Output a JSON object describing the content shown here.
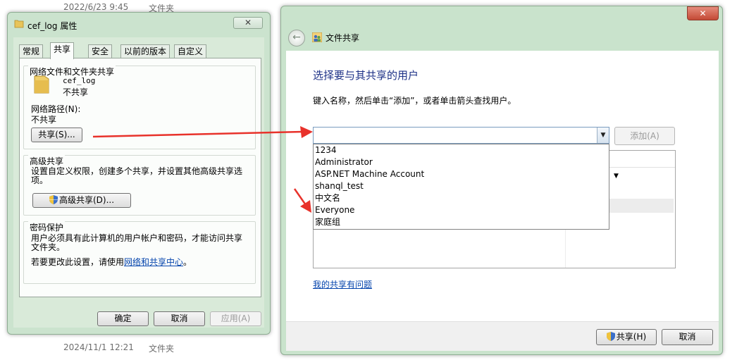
{
  "background": {
    "rows": [
      {
        "date": "2022/6/23 9:45",
        "type": "文件夹"
      },
      {
        "date": "2024/11/1 12:21",
        "type": "文件夹"
      }
    ]
  },
  "properties": {
    "title": "cef_log 属性",
    "close_label": "✕",
    "tabs": [
      "常规",
      "共享",
      "安全",
      "以前的版本",
      "自定义"
    ],
    "network_share": {
      "title": "网络文件和文件夹共享",
      "folder_name": "cef_log",
      "status": "不共享",
      "path_label": "网络路径(N):",
      "path_value": "不共享",
      "share_button": "共享(S)..."
    },
    "advanced": {
      "title": "高级共享",
      "description_line1": "设置自定义权限，创建多个共享，并设置其他高级共享选",
      "description_line2": "项。",
      "button": "高级共享(D)..."
    },
    "password": {
      "title": "密码保护",
      "line1": "用户必须具有此计算机的用户帐户和密码，才能访问共享",
      "line2": "文件夹。",
      "change_text": "若要更改此设置，请使用",
      "link_text": "网络和共享中心",
      "after_link": "。"
    },
    "buttons": {
      "ok": "确定",
      "cancel": "取消",
      "apply": "应用(A)"
    }
  },
  "share_dialog": {
    "close_label": "✕",
    "back_icon": "←",
    "title": "文件共享",
    "heading": "选择要与其共享的用户",
    "instruction": "键入名称，然后单击“添加”，或者单击箭头查找用户。",
    "input_value": "",
    "add_button": "添加(A)",
    "dropdown_items": [
      "1234",
      "Administrator",
      "ASP.NET Machine Account",
      "shanql_test",
      "中文名",
      "Everyone",
      "家庭组"
    ],
    "help_link": "我的共享有问题",
    "share_button": "共享(H)",
    "cancel_button": "取消"
  },
  "colors": {
    "arrow": "#e8322b",
    "heading": "#1e3287",
    "window_frame": "#c9e3cc"
  }
}
